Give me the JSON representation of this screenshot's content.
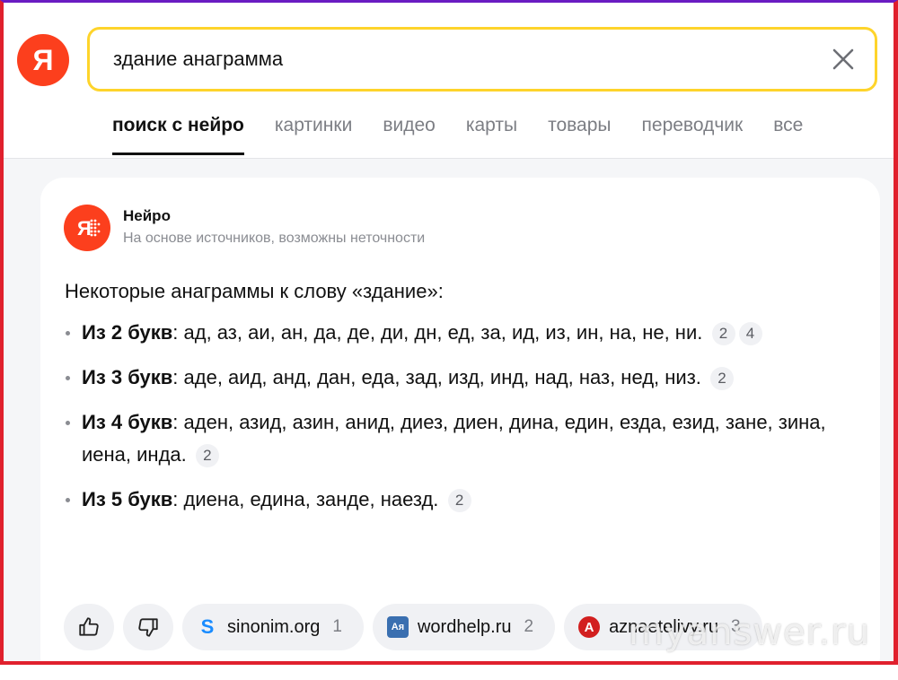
{
  "search": {
    "query": "здание анаграмма"
  },
  "tabs": [
    {
      "label": "поиск с нейро",
      "active": true
    },
    {
      "label": "картинки"
    },
    {
      "label": "видео"
    },
    {
      "label": "карты"
    },
    {
      "label": "товары"
    },
    {
      "label": "переводчик"
    },
    {
      "label": "все"
    }
  ],
  "neuro": {
    "title": "Нейро",
    "subtitle": "На основе источников, возможны неточности",
    "intro": "Некоторые анаграммы к слову «здание»:",
    "items": [
      {
        "label": "Из 2 букв",
        "text": ": ад, аз, аи, ан, да, де, ди, дн, ед, за, ид, из, ин, на, не, ни.",
        "refs": [
          "2",
          "4"
        ]
      },
      {
        "label": "Из 3 букв",
        "text": ": аде, аид, анд, дан, еда, зад, изд, инд, над, наз, нед, низ.",
        "refs": [
          "2"
        ]
      },
      {
        "label": "Из 4 букв",
        "text": ": аден, азид, азин, анид, диез, диен, дина, един, езда, езид, зане, зина, иена, инда.",
        "refs": [
          "2"
        ]
      },
      {
        "label": "Из 5 букв",
        "text": ": диена, едина, занде, наезд.",
        "refs": [
          "2"
        ]
      }
    ]
  },
  "sources": [
    {
      "name": "sinonim.org",
      "count": "1",
      "favicon": "S",
      "color": "#1a8cff"
    },
    {
      "name": "wordhelp.ru",
      "count": "2",
      "favicon": "Aя",
      "color": "#3a6fb0"
    },
    {
      "name": "aznaetelivy.ru",
      "count": "3",
      "favicon": "A",
      "color": "#d21f1f"
    }
  ],
  "icons": {
    "logo": "Я",
    "thumbs_up": "thumbs-up-icon",
    "thumbs_down": "thumbs-down-icon",
    "clear": "close-icon"
  },
  "watermark": "myanswer.ru"
}
